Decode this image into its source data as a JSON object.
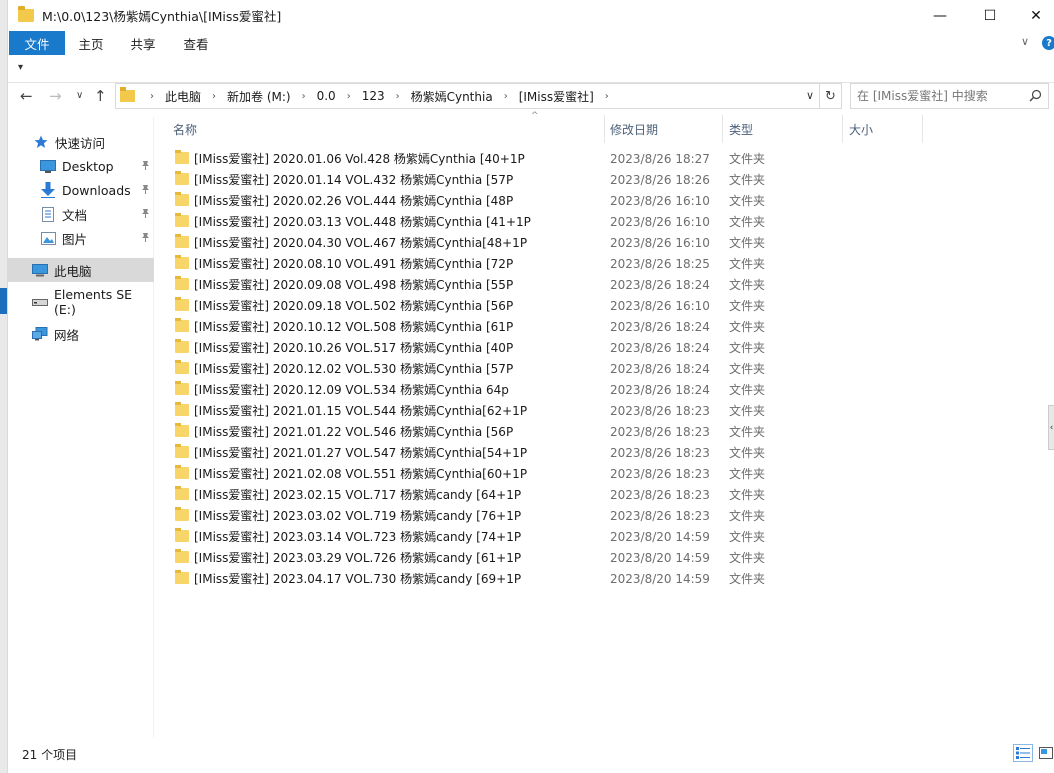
{
  "window": {
    "title": "M:\\0.0\\123\\杨紫嫣Cynthia\\[IMiss爱蜜社]",
    "minimize_glyph": "—",
    "maximize_glyph": "☐",
    "close_glyph": "✕"
  },
  "ribbon": {
    "tabs": [
      "文件",
      "主页",
      "共享",
      "查看"
    ],
    "expand_glyph": "∨",
    "help_glyph": "?"
  },
  "qat": {
    "dropdown_glyph": "▾"
  },
  "nav": {
    "back": "←",
    "forward": "→",
    "recent": "∨",
    "up": "↑",
    "breadcrumb": [
      "此电脑",
      "新加卷 (M:)",
      "0.0",
      "123",
      "杨紫嫣Cynthia",
      "[IMiss爱蜜社]"
    ],
    "breadcrumb_sep": "›",
    "dropdown": "∨",
    "refresh": "↻"
  },
  "search": {
    "placeholder": "在 [IMiss爱蜜社] 中搜索"
  },
  "sidebar": {
    "quick_access": "快速访问",
    "items": [
      {
        "label": "Desktop",
        "icon": "desktop-icon",
        "pinned": true
      },
      {
        "label": "Downloads",
        "icon": "downloads-icon",
        "pinned": true
      },
      {
        "label": "文档",
        "icon": "documents-icon",
        "pinned": true
      },
      {
        "label": "图片",
        "icon": "pictures-icon",
        "pinned": true
      }
    ],
    "this_pc": "此电脑",
    "drive": "Elements SE (E:)",
    "network": "网络",
    "pin_glyph": "📌"
  },
  "columns": {
    "name": "名称",
    "date": "修改日期",
    "type": "类型",
    "size": "大小",
    "sort_glyph": "^"
  },
  "rows": [
    {
      "name": "[IMiss爱蜜社] 2020.01.06 Vol.428 杨紫嫣Cynthia [40+1P",
      "date": "2023/8/26 18:27",
      "type": "文件夹"
    },
    {
      "name": "[IMiss爱蜜社] 2020.01.14 VOL.432 杨紫嫣Cynthia [57P",
      "date": "2023/8/26 18:26",
      "type": "文件夹"
    },
    {
      "name": "[IMiss爱蜜社] 2020.02.26 VOL.444 杨紫嫣Cynthia [48P",
      "date": "2023/8/26 16:10",
      "type": "文件夹"
    },
    {
      "name": "[IMiss爱蜜社] 2020.03.13 VOL.448 杨紫嫣Cynthia [41+1P",
      "date": "2023/8/26 16:10",
      "type": "文件夹"
    },
    {
      "name": "[IMiss爱蜜社] 2020.04.30 VOL.467 杨紫嫣Cynthia[48+1P",
      "date": "2023/8/26 16:10",
      "type": "文件夹"
    },
    {
      "name": "[IMiss爱蜜社] 2020.08.10 VOL.491 杨紫嫣Cynthia [72P",
      "date": "2023/8/26 18:25",
      "type": "文件夹"
    },
    {
      "name": "[IMiss爱蜜社] 2020.09.08 VOL.498 杨紫嫣Cynthia [55P",
      "date": "2023/8/26 18:24",
      "type": "文件夹"
    },
    {
      "name": "[IMiss爱蜜社] 2020.09.18 VOL.502 杨紫嫣Cynthia [56P",
      "date": "2023/8/26 16:10",
      "type": "文件夹"
    },
    {
      "name": "[IMiss爱蜜社] 2020.10.12 VOL.508 杨紫嫣Cynthia [61P",
      "date": "2023/8/26 18:24",
      "type": "文件夹"
    },
    {
      "name": "[IMiss爱蜜社] 2020.10.26 VOL.517 杨紫嫣Cynthia [40P",
      "date": "2023/8/26 18:24",
      "type": "文件夹"
    },
    {
      "name": "[IMiss爱蜜社] 2020.12.02 VOL.530 杨紫嫣Cynthia [57P",
      "date": "2023/8/26 18:24",
      "type": "文件夹"
    },
    {
      "name": "[IMiss爱蜜社] 2020.12.09 VOL.534 杨紫嫣Cynthia 64p",
      "date": "2023/8/26 18:24",
      "type": "文件夹"
    },
    {
      "name": "[IMiss爱蜜社] 2021.01.15 VOL.544 杨紫嫣Cynthia[62+1P",
      "date": "2023/8/26 18:23",
      "type": "文件夹"
    },
    {
      "name": "[IMiss爱蜜社] 2021.01.22 VOL.546 杨紫嫣Cynthia [56P",
      "date": "2023/8/26 18:23",
      "type": "文件夹"
    },
    {
      "name": "[IMiss爱蜜社] 2021.01.27 VOL.547 杨紫嫣Cynthia[54+1P",
      "date": "2023/8/26 18:23",
      "type": "文件夹"
    },
    {
      "name": "[IMiss爱蜜社] 2021.02.08 VOL.551 杨紫嫣Cynthia[60+1P",
      "date": "2023/8/26 18:23",
      "type": "文件夹"
    },
    {
      "name": "[IMiss爱蜜社] 2023.02.15 VOL.717 杨紫嫣candy [64+1P",
      "date": "2023/8/26 18:23",
      "type": "文件夹"
    },
    {
      "name": "[IMiss爱蜜社] 2023.03.02 VOL.719 杨紫嫣candy [76+1P",
      "date": "2023/8/26 18:23",
      "type": "文件夹"
    },
    {
      "name": "[IMiss爱蜜社] 2023.03.14 VOL.723 杨紫嫣candy [74+1P",
      "date": "2023/8/20 14:59",
      "type": "文件夹"
    },
    {
      "name": "[IMiss爱蜜社] 2023.03.29 VOL.726 杨紫嫣candy [61+1P",
      "date": "2023/8/20 14:59",
      "type": "文件夹"
    },
    {
      "name": "[IMiss爱蜜社] 2023.04.17 VOL.730 杨紫嫣candy [69+1P",
      "date": "2023/8/20 14:59",
      "type": "文件夹"
    }
  ],
  "status": {
    "count": "21 个项目"
  },
  "colors": {
    "accent": "#1979ca",
    "folder": "#f7d568",
    "selected": "#d9d9d9"
  }
}
